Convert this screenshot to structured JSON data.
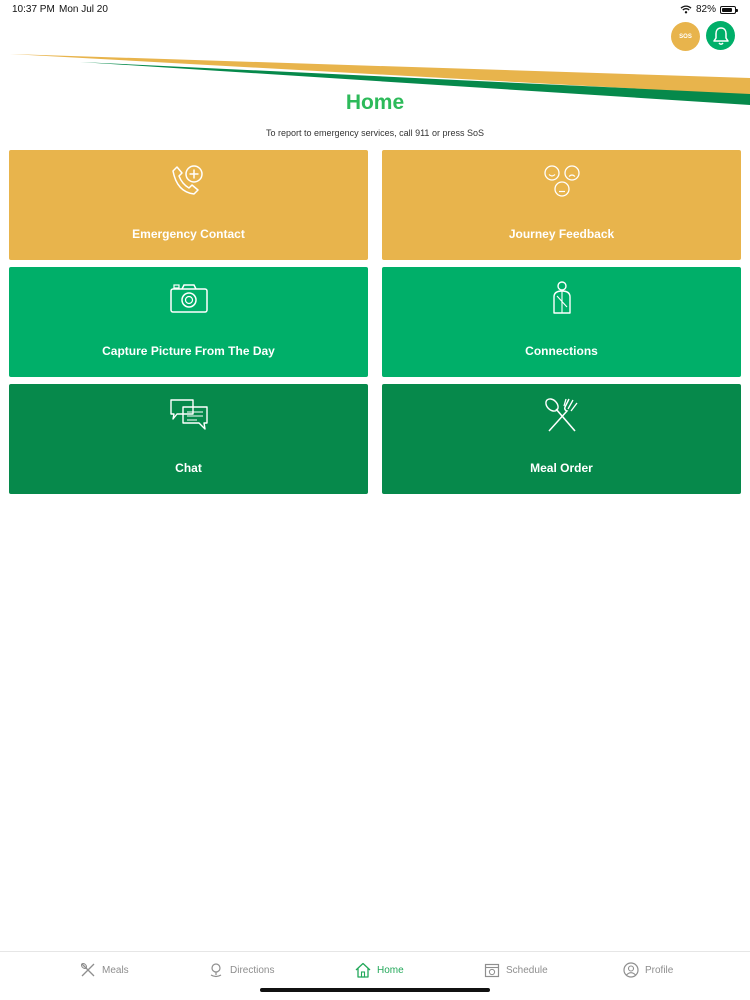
{
  "status_bar": {
    "time": "10:37 PM",
    "date": "Mon Jul 20",
    "battery_pct": "82%",
    "battery_level": 0.82
  },
  "header": {
    "sos_label": "SOS"
  },
  "title": "Home",
  "subtitle": "To report to emergency services, call 911 or press SoS",
  "colors": {
    "gold": "#E8B44C",
    "green": "#00AF69",
    "dark_green": "#06894B",
    "title_green": "#2DBA5A",
    "active_tab": "#23A85A"
  },
  "tiles": [
    {
      "label": "Emergency Contact",
      "icon": "phone-plus-icon"
    },
    {
      "label": "Journey Feedback",
      "icon": "faces-icon"
    },
    {
      "label": "Capture Picture From The Day",
      "icon": "camera-icon"
    },
    {
      "label": "Connections",
      "icon": "person-icon"
    },
    {
      "label": "Chat",
      "icon": "chat-bubbles-icon"
    },
    {
      "label": "Meal Order",
      "icon": "fork-spoon-icon"
    }
  ],
  "tabs": [
    {
      "label": "Meals",
      "icon": "utensils-icon",
      "active": false
    },
    {
      "label": "Directions",
      "icon": "map-pin-icon",
      "active": false
    },
    {
      "label": "Home",
      "icon": "home-icon",
      "active": true
    },
    {
      "label": "Schedule",
      "icon": "calendar-icon",
      "active": false
    },
    {
      "label": "Profile",
      "icon": "profile-icon",
      "active": false
    }
  ]
}
